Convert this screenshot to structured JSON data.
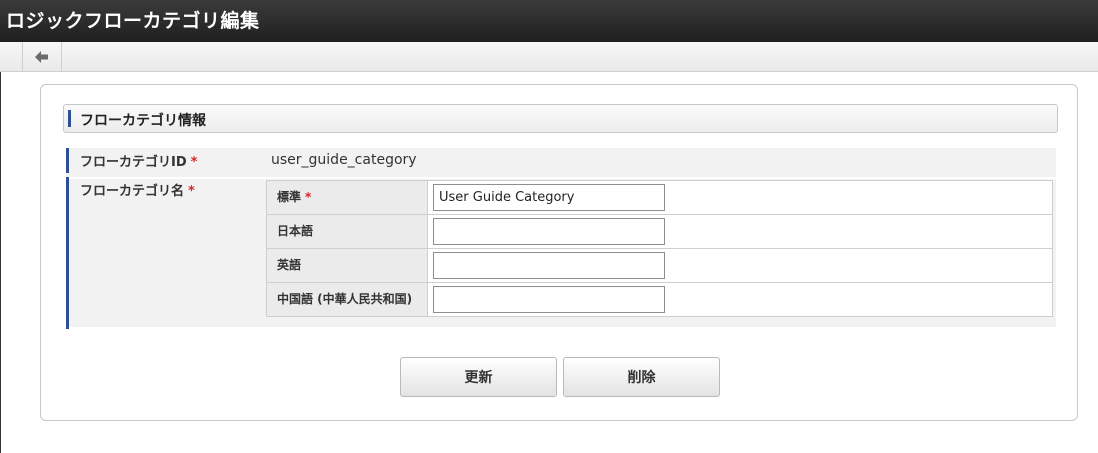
{
  "window": {
    "title": "ロジックフローカテゴリ編集"
  },
  "toolbar": {
    "back_icon": "arrow-left-icon"
  },
  "section": {
    "title": "フローカテゴリ情報"
  },
  "required_mark": "*",
  "fields": {
    "category_id": {
      "label": "フローカテゴリID",
      "value": "user_guide_category"
    },
    "category_name": {
      "label": "フローカテゴリ名",
      "languages": [
        {
          "label": "標準",
          "required": true,
          "value": "User Guide Category"
        },
        {
          "label": "日本語",
          "required": false,
          "value": ""
        },
        {
          "label": "英語",
          "required": false,
          "value": ""
        },
        {
          "label": "中国語 (中華人民共和国)",
          "required": false,
          "value": ""
        }
      ]
    }
  },
  "buttons": {
    "update_label": "更新",
    "delete_label": "削除"
  },
  "colors": {
    "accent": "#2e5096",
    "required": "#d9232d",
    "title_bar": "#2b2b2b"
  }
}
